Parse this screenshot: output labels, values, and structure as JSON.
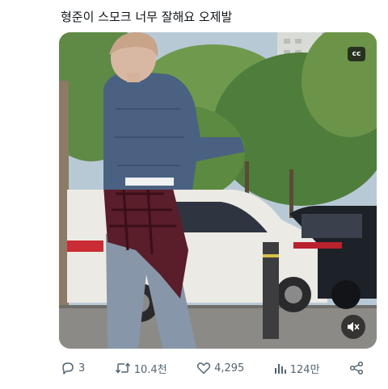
{
  "post": {
    "text": "형준이 스모크 너무 잘해요 오제발"
  },
  "media": {
    "caption_badge": "cc",
    "mute_icon": "speaker-muted-icon"
  },
  "actions": {
    "replies": "3",
    "reposts": "10.4천",
    "likes": "4,295",
    "views": "124만"
  },
  "colors": {
    "text": "#0f1419",
    "icon_gray": "#536471"
  }
}
